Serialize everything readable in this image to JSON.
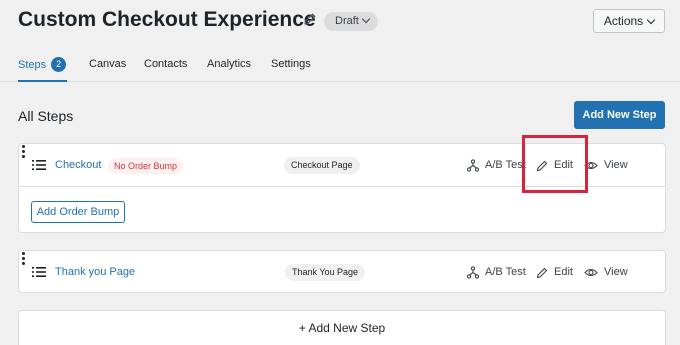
{
  "header": {
    "title": "Custom Checkout Experience",
    "status_badge": "Draft",
    "actions_label": "Actions"
  },
  "tabs": {
    "steps_label": "Steps",
    "steps_count": "2",
    "canvas_label": "Canvas",
    "contacts_label": "Contacts",
    "analytics_label": "Analytics",
    "settings_label": "Settings"
  },
  "section": {
    "title": "All Steps",
    "add_step_label": "Add New Step"
  },
  "steps": [
    {
      "name": "Checkout",
      "warning_badge": "No Order Bump",
      "type_badge": "Checkout Page",
      "ab_test_label": "A/B Test",
      "edit_label": "Edit",
      "view_label": "View",
      "add_bump_label": "Add Order Bump"
    },
    {
      "name": "Thank you Page",
      "type_badge": "Thank You Page",
      "ab_test_label": "A/B Test",
      "edit_label": "Edit",
      "view_label": "View"
    }
  ],
  "footer": {
    "add_new_step_label": "+ Add New Step"
  },
  "colors": {
    "accent": "#2271b1",
    "warning": "#d63638",
    "highlight": "#d6243f"
  },
  "icons": [
    "pencil-icon",
    "chevron-down-icon",
    "drag-handle-icon",
    "ab-test-icon",
    "edit-icon",
    "eye-icon",
    "more-vertical-icon"
  ]
}
